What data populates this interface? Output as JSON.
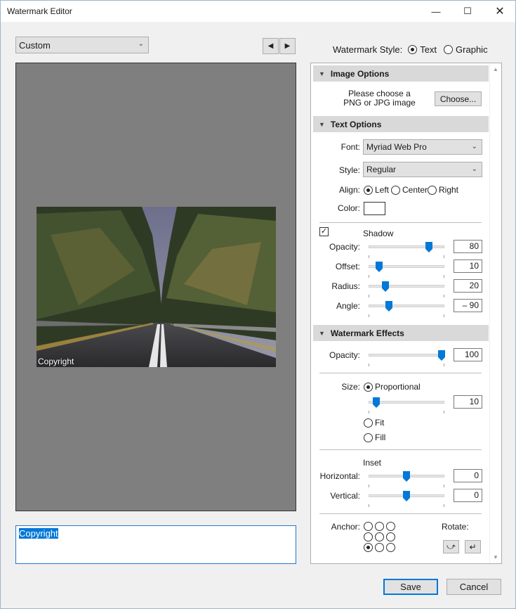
{
  "window": {
    "title": "Watermark Editor"
  },
  "preset": {
    "selected": "Custom"
  },
  "watermark_style": {
    "label": "Watermark Style:",
    "options": [
      "Text",
      "Graphic"
    ],
    "selected": "Text"
  },
  "preview": {
    "overlay_text": "Copyright"
  },
  "text_input": {
    "value": "Copyright"
  },
  "image_options": {
    "header": "Image Options",
    "prompt_line1": "Please choose a",
    "prompt_line2": "PNG or JPG image",
    "choose_label": "Choose..."
  },
  "text_options": {
    "header": "Text Options",
    "font_label": "Font:",
    "font_value": "Myriad Web Pro",
    "style_label": "Style:",
    "style_value": "Regular",
    "align_label": "Align:",
    "align_options": [
      "Left",
      "Center",
      "Right"
    ],
    "align_selected": "Left",
    "color_label": "Color:",
    "color_value": "#ffffff",
    "shadow_label": "Shadow",
    "shadow_checked": true,
    "opacity_label": "Opacity:",
    "opacity_value": "80",
    "offset_label": "Offset:",
    "offset_value": "10",
    "radius_label": "Radius:",
    "radius_value": "20",
    "angle_label": "Angle:",
    "angle_value": "– 90"
  },
  "effects": {
    "header": "Watermark Effects",
    "opacity_label": "Opacity:",
    "opacity_value": "100",
    "size_label": "Size:",
    "size_options": [
      "Proportional",
      "Fit",
      "Fill"
    ],
    "size_selected": "Proportional",
    "size_value": "10",
    "inset_label": "Inset",
    "horizontal_label": "Horizontal:",
    "horizontal_value": "0",
    "vertical_label": "Vertical:",
    "vertical_value": "0",
    "anchor_label": "Anchor:",
    "anchor_selected": "bottom-left",
    "rotate_label": "Rotate:"
  },
  "sliders": {
    "shadow_opacity": 0.8,
    "shadow_offset": 0.14,
    "shadow_radius": 0.22,
    "shadow_angle": 0.27,
    "effect_opacity": 0.96,
    "size": 0.1,
    "horizontal": 0.5,
    "vertical": 0.5
  },
  "footer": {
    "save_label": "Save",
    "cancel_label": "Cancel"
  },
  "colors": {
    "accent": "#0078d7",
    "preview_bg": "#7f7f7f",
    "section_header": "#d9d9d9"
  }
}
